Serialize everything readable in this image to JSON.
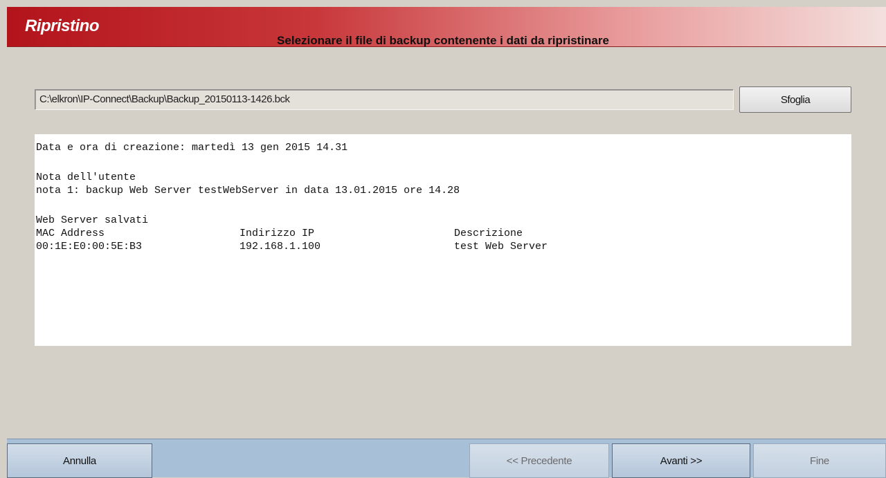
{
  "window": {
    "title": "Ripristino"
  },
  "instruction": "Selezionare il file di backup contenente i dati da ripristinare",
  "file": {
    "path": "C:\\elkron\\IP-Connect\\Backup\\Backup_20150113-1426.bck",
    "browse_label": "Sfoglia"
  },
  "info": {
    "creation_line": "Data e ora di creazione: martedì 13 gen 2015 14.31",
    "note_heading": "Nota dell'utente",
    "note_text": "nota 1: backup Web Server testWebServer in data 13.01.2015 ore 14.28",
    "servers_heading": "Web Server salvati",
    "columns": [
      "MAC Address",
      "Indirizzo IP",
      "Descrizione"
    ],
    "rows": [
      {
        "mac": "00:1E:E0:00:5E:B3",
        "ip": "192.168.1.100",
        "description": "test Web Server"
      }
    ]
  },
  "footer": {
    "cancel_label": "Annulla",
    "prev_label": "<< Precedente",
    "next_label": "Avanti >>",
    "finish_label": "Fine"
  },
  "colors": {
    "title_gradient_start": "#b3141b",
    "footer_background": "#a8bfd8",
    "window_background": "#d4d0c8"
  }
}
